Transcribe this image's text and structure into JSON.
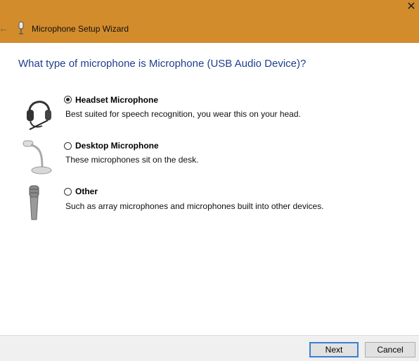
{
  "window": {
    "title": "Microphone Setup Wizard",
    "close_glyph": "✕",
    "back_glyph": "←"
  },
  "heading": "What type of microphone is Microphone (USB Audio Device)?",
  "options": [
    {
      "label": "Headset Microphone",
      "description": "Best suited for speech recognition, you wear this on your head.",
      "selected": true,
      "icon": "headset-icon"
    },
    {
      "label": "Desktop Microphone",
      "description": "These microphones sit on the desk.",
      "selected": false,
      "icon": "desktop-microphone-icon"
    },
    {
      "label": "Other",
      "description": "Such as array microphones and microphones built into other devices.",
      "selected": false,
      "icon": "handheld-microphone-icon"
    }
  ],
  "buttons": {
    "next": "Next",
    "cancel": "Cancel"
  },
  "colors": {
    "titlebar": "#D28C2C",
    "heading": "#1c3f8f",
    "footer": "#f0f0f0",
    "default_button_border": "#3c7fd0"
  }
}
